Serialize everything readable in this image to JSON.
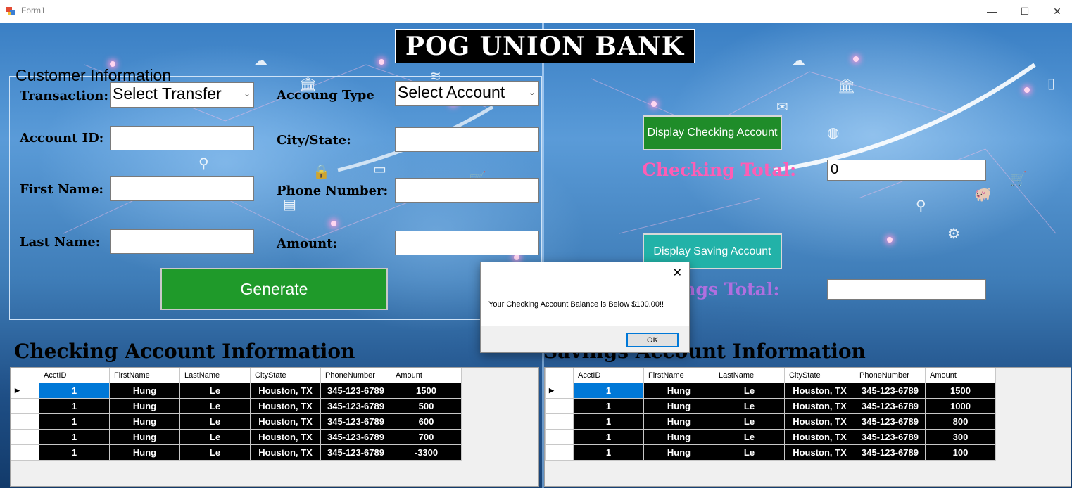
{
  "window": {
    "title": "Form1",
    "minimize_glyph": "—",
    "maximize_glyph": "☐",
    "close_glyph": "✕"
  },
  "bank_title": "POG UNION BANK",
  "customer_info": {
    "group_title": "Customer Information",
    "transaction_label": "Transaction:",
    "transaction_value": "Select Transfer",
    "account_type_label": "Accoung Type",
    "account_type_value": "Select Account",
    "account_id_label": "Account ID:",
    "city_state_label": "City/State:",
    "first_name_label": "First Name:",
    "phone_label": "Phone Number:",
    "last_name_label": "Last Name:",
    "amount_label": "Amount:",
    "generate_label": "Generate"
  },
  "right_panel": {
    "display_checking_label": "Display Checking Account",
    "checking_total_label": "Checking Total:",
    "checking_total_value": "0",
    "display_saving_label": "Display Saving Account",
    "savings_total_label": "Savings Total:",
    "savings_total_value": ""
  },
  "checking_section": {
    "title": "Checking Account Information",
    "columns": [
      "AcctID",
      "FirstName",
      "LastName",
      "CityState",
      "PhoneNumber",
      "Amount"
    ],
    "rows": [
      [
        "1",
        "Hung",
        "Le",
        "Houston, TX",
        "345-123-6789",
        "1500"
      ],
      [
        "1",
        "Hung",
        "Le",
        "Houston, TX",
        "345-123-6789",
        "500"
      ],
      [
        "1",
        "Hung",
        "Le",
        "Houston, TX",
        "345-123-6789",
        "600"
      ],
      [
        "1",
        "Hung",
        "Le",
        "Houston, TX",
        "345-123-6789",
        "700"
      ],
      [
        "1",
        "Hung",
        "Le",
        "Houston, TX",
        "345-123-6789",
        "-3300"
      ]
    ]
  },
  "savings_section": {
    "title": "Savings Account Information",
    "columns": [
      "AcctID",
      "FirstName",
      "LastName",
      "CityState",
      "PhoneNumber",
      "Amount"
    ],
    "rows": [
      [
        "1",
        "Hung",
        "Le",
        "Houston, TX",
        "345-123-6789",
        "1500"
      ],
      [
        "1",
        "Hung",
        "Le",
        "Houston, TX",
        "345-123-6789",
        "1000"
      ],
      [
        "1",
        "Hung",
        "Le",
        "Houston, TX",
        "345-123-6789",
        "800"
      ],
      [
        "1",
        "Hung",
        "Le",
        "Houston, TX",
        "345-123-6789",
        "300"
      ],
      [
        "1",
        "Hung",
        "Le",
        "Houston, TX",
        "345-123-6789",
        "100"
      ]
    ]
  },
  "dialog": {
    "message": "Your Checking Account Balance is Below $100.00!!",
    "ok_label": "OK",
    "close_glyph": "✕"
  },
  "colors": {
    "generate": "#1f9a2a",
    "display_checking": "#1f8c29",
    "display_saving": "#22b2a8",
    "checking_total_text": "#ff5db4",
    "savings_total_text": "#b06fe0"
  }
}
